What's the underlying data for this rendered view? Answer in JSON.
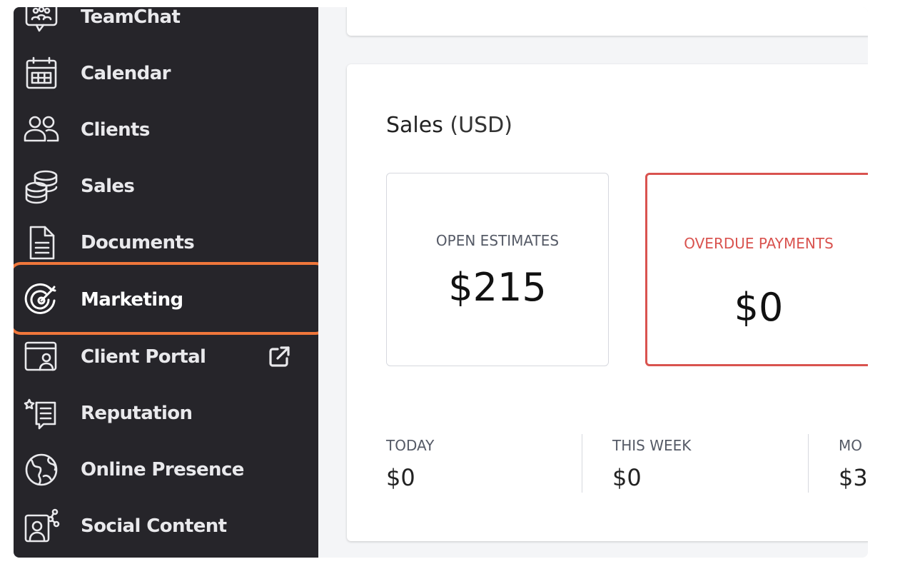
{
  "sidebar": {
    "items": [
      {
        "label": "TeamChat",
        "icon": "chat-bubble-team-icon"
      },
      {
        "label": "Calendar",
        "icon": "calendar-icon"
      },
      {
        "label": "Clients",
        "icon": "people-icon"
      },
      {
        "label": "Sales",
        "icon": "coins-icon"
      },
      {
        "label": "Documents",
        "icon": "document-icon"
      },
      {
        "label": "Marketing",
        "icon": "target-icon",
        "active": true
      },
      {
        "label": "Client Portal",
        "icon": "client-portal-icon",
        "external": true
      },
      {
        "label": "Reputation",
        "icon": "reputation-icon"
      },
      {
        "label": "Online Presence",
        "icon": "globe-icon"
      },
      {
        "label": "Social Content",
        "icon": "social-content-icon"
      }
    ],
    "external_icon": "external-link-icon"
  },
  "sales": {
    "title": "Sales",
    "unit": "(USD)",
    "open_estimates": {
      "label": "OPEN ESTIMATES",
      "value": "$215"
    },
    "overdue_payments": {
      "label": "OVERDUE PAYMENTS",
      "value": "$0"
    },
    "periods": [
      {
        "label": "TODAY",
        "value": "$0"
      },
      {
        "label": "THIS WEEK",
        "value": "$0"
      },
      {
        "label": "MO",
        "value": "$3"
      }
    ]
  },
  "colors": {
    "sidebar_bg": "#26252a",
    "highlight": "#f0773b",
    "overdue": "#d9534f"
  }
}
